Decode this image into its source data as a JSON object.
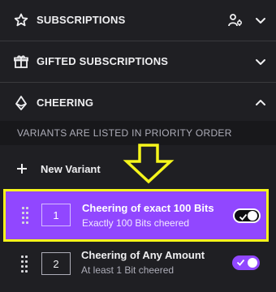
{
  "sections": {
    "subscriptions": {
      "title": "SUBSCRIPTIONS",
      "icon": "star-icon"
    },
    "gifted": {
      "title": "GIFTED SUBSCRIPTIONS",
      "icon": "gift-icon"
    },
    "cheering": {
      "title": "CHEERING",
      "icon": "bits-icon",
      "expanded": true
    }
  },
  "hint": "VARIANTS ARE LISTED IN PRIORITY ORDER",
  "new_variant_label": "New Variant",
  "variants": [
    {
      "number": "1",
      "title": "Cheering of exact 100 Bits",
      "subtitle": "Exactly 100 Bits cheered",
      "enabled": true,
      "selected": true
    },
    {
      "number": "2",
      "title": "Cheering of Any Amount",
      "subtitle": "At least 1 Bit cheered",
      "enabled": true,
      "selected": false
    }
  ],
  "colors": {
    "accent": "#9147ff",
    "highlight": "#f5f51b",
    "background": "#1f1f23"
  }
}
